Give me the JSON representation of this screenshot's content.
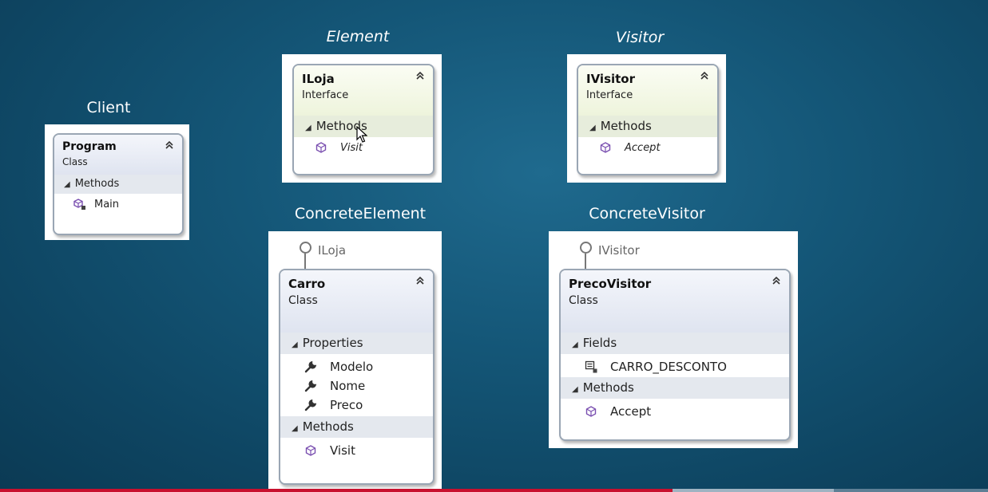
{
  "roles": {
    "client": "Client",
    "element": "Element",
    "visitor": "Visitor",
    "concrete_element": "ConcreteElement",
    "concrete_visitor": "ConcreteVisitor"
  },
  "program": {
    "name": "Program",
    "type": "Class",
    "sections": [
      {
        "title": "Methods",
        "members": [
          "Main"
        ]
      }
    ]
  },
  "iloja": {
    "name": "ILoja",
    "type": "Interface",
    "sections": [
      {
        "title": "Methods",
        "members": [
          "Visit"
        ]
      }
    ]
  },
  "ivisitor": {
    "name": "IVisitor",
    "type": "Interface",
    "sections": [
      {
        "title": "Methods",
        "members": [
          "Accept"
        ]
      }
    ]
  },
  "carro": {
    "implements": "ILoja",
    "name": "Carro",
    "type": "Class",
    "sections": [
      {
        "title": "Properties",
        "members": [
          "Modelo",
          "Nome",
          "Preco"
        ]
      },
      {
        "title": "Methods",
        "members": [
          "Visit"
        ]
      }
    ]
  },
  "precovisitor": {
    "implements": "IVisitor",
    "name": "PrecoVisitor",
    "type": "Class",
    "sections": [
      {
        "title": "Fields",
        "members": [
          "CARRO_DESCONTO"
        ]
      },
      {
        "title": "Methods",
        "members": [
          "Accept"
        ]
      }
    ]
  },
  "icons": {
    "collapse": "double-chevron-up-icon",
    "section": "triangle-expanded-icon",
    "method": "method-cube-icon",
    "private_method": "private-method-icon",
    "property": "wrench-icon",
    "field": "private-field-icon"
  },
  "colors": {
    "progress_played": "#c8102e",
    "progress_buffered": "#9fb3c2"
  }
}
